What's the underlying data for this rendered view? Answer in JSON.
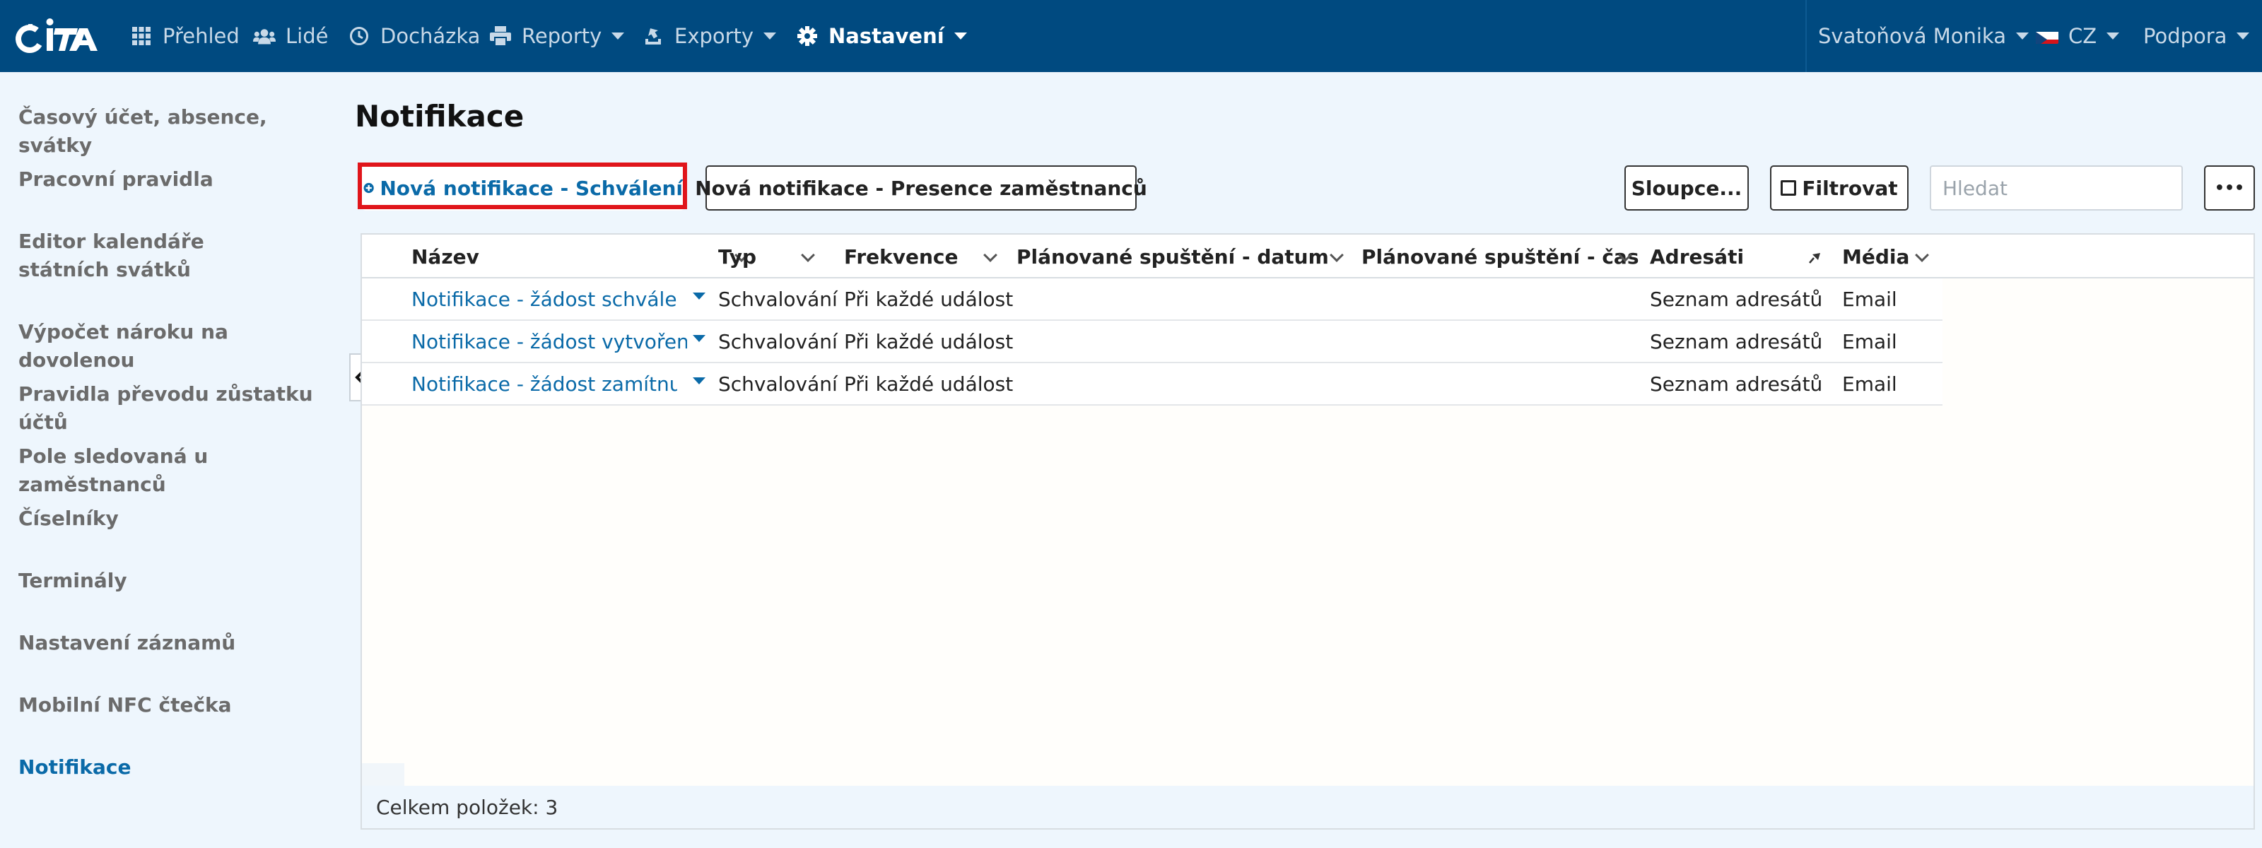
{
  "topnav": {
    "items": [
      {
        "label": "Přehled",
        "icon": "grid-icon"
      },
      {
        "label": "Lidé",
        "icon": "users-icon"
      },
      {
        "label": "Docházka",
        "icon": "clock-icon"
      },
      {
        "label": "Reporty",
        "icon": "printer-icon"
      },
      {
        "label": "Exporty",
        "icon": "export-icon"
      },
      {
        "label": "Nastavení",
        "icon": "gear-icon"
      }
    ],
    "user": "Svatoňová Monika",
    "language": "CZ",
    "support": "Podpora",
    "colors": {
      "bar": "#004a80",
      "accent": "#0a6aa8",
      "highlight": "#e0151b"
    }
  },
  "sidebar": {
    "items": [
      {
        "label": "Časový účet, absence, svátky"
      },
      {
        "label": "Pracovní pravidla"
      },
      {
        "label": "Editor kalendáře státních svátků"
      },
      {
        "label": "Výpočet nároku na dovolenou"
      },
      {
        "label": "Pravidla převodu zůstatku účtů"
      },
      {
        "label": "Pole sledovaná u zaměstnanců"
      },
      {
        "label": "Číselníky"
      },
      {
        "label": "Terminály"
      },
      {
        "label": "Nastavení záznamů"
      },
      {
        "label": "Mobilní NFC čtečka"
      },
      {
        "label": "Notifikace"
      }
    ]
  },
  "main": {
    "title": "Notifikace",
    "btn_new_approval": "Nová notifikace - Schválení",
    "btn_new_presence": "Nová notifikace - Presence zaměstnanců",
    "btn_columns": "Sloupce...",
    "btn_filter": "Filtrovat",
    "search_placeholder": "Hledat",
    "btn_more": "•••"
  },
  "grid": {
    "columns": [
      "Název",
      "Typ",
      "Frekvence",
      "Plánované spuštění - datum",
      "Plánované spuštění - čas",
      "Adresáti",
      "Média"
    ],
    "rows": [
      {
        "name": "Notifikace - žádost schvále...",
        "type": "Schvalování",
        "freq": "Při každé události",
        "date": "",
        "time": "",
        "recipients": "Seznam adresátů",
        "media": "Email"
      },
      {
        "name": "Notifikace - žádost vytvořena",
        "type": "Schvalování",
        "freq": "Při každé události",
        "date": "",
        "time": "",
        "recipients": "Seznam adresátů",
        "media": "Email"
      },
      {
        "name": "Notifikace - žádost zamítnu...",
        "type": "Schvalování",
        "freq": "Při každé události",
        "date": "",
        "time": "",
        "recipients": "Seznam adresátů",
        "media": "Email"
      }
    ],
    "footer": "Celkem položek: 3"
  }
}
